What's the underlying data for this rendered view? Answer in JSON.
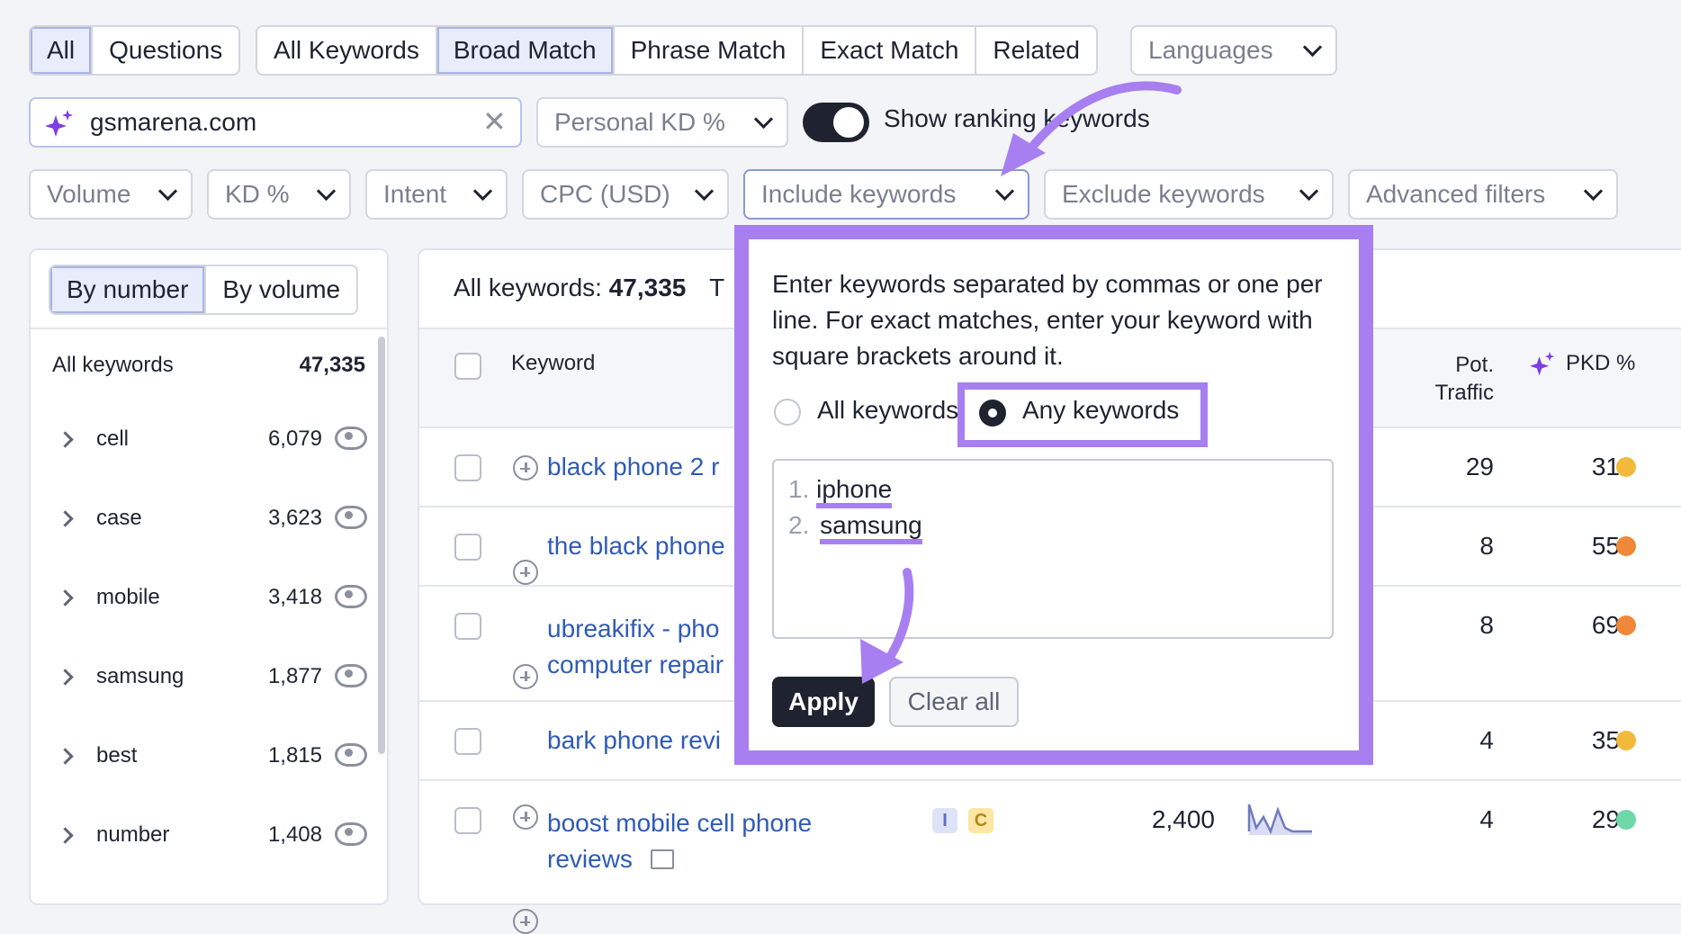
{
  "intent_tabs": [
    "All",
    "Questions"
  ],
  "match_tabs": [
    "All Keywords",
    "Broad Match",
    "Phrase Match",
    "Exact Match",
    "Related"
  ],
  "languages_label": "Languages",
  "search": {
    "value": "gsmarena.com"
  },
  "personal_kd_label": "Personal KD %",
  "show_ranking_label": "Show ranking keywords",
  "filters": {
    "volume": "Volume",
    "kd": "KD %",
    "intent": "Intent",
    "cpc": "CPC (USD)",
    "include": "Include keywords",
    "exclude": "Exclude keywords",
    "advanced": "Advanced filters"
  },
  "sidebar": {
    "tabs": [
      "By number",
      "By volume"
    ],
    "total_label": "All keywords",
    "total_count": "47,335",
    "groups": [
      {
        "label": "cell",
        "count": "6,079"
      },
      {
        "label": "case",
        "count": "3,623"
      },
      {
        "label": "mobile",
        "count": "3,418"
      },
      {
        "label": "samsung",
        "count": "1,877"
      },
      {
        "label": "best",
        "count": "1,815"
      },
      {
        "label": "number",
        "count": "1,408"
      }
    ]
  },
  "main": {
    "summary_label": "All keywords:",
    "summary_count": "47,335",
    "summary_tail": "T",
    "col_keyword": "Keyword",
    "col_traffic_1": "Pot.",
    "col_traffic_2": "Traffic",
    "col_pkd": "PKD %",
    "rows": [
      {
        "kw1": "black phone 2 r",
        "kw2": "",
        "traffic": "29",
        "pkd": "31",
        "color": "#f2b93b"
      },
      {
        "kw1": "the black phone",
        "kw2": "",
        "traffic": "8",
        "pkd": "55",
        "color": "#f0883a"
      },
      {
        "kw1": "ubreakifix - pho",
        "kw2": "computer repair",
        "traffic": "8",
        "pkd": "69",
        "color": "#f0883a"
      },
      {
        "kw1": "bark phone revi",
        "kw2": "",
        "traffic": "4",
        "pkd": "35",
        "color": "#f2b93b"
      },
      {
        "kw1": "boost mobile cell phone",
        "kw2": "reviews",
        "traffic": "4",
        "pkd": "29",
        "color": "#6ed8a8",
        "intent1": "I",
        "intent2": "C",
        "volume": "2,400"
      }
    ]
  },
  "popup": {
    "instructions": "Enter keywords separated by commas or one per line. For exact matches, enter your keyword with square brackets around it.",
    "option_all": "All keywords",
    "option_any": "Any keywords",
    "lines": [
      {
        "num": "1.",
        "text": "iphone"
      },
      {
        "num": "2.",
        "text": "samsung"
      }
    ],
    "apply": "Apply",
    "clear": "Clear all"
  },
  "colors": {
    "accent": "#a77ff0",
    "link": "#2f5bb7"
  }
}
